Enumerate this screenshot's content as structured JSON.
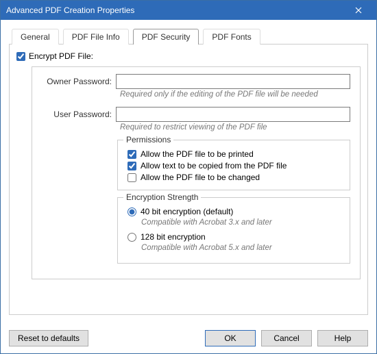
{
  "window": {
    "title": "Advanced PDF Creation Properties"
  },
  "tabs": {
    "general": "General",
    "fileinfo": "PDF File Info",
    "security": "PDF Security",
    "fonts": "PDF Fonts"
  },
  "encrypt": {
    "label": "Encrypt PDF File:"
  },
  "owner": {
    "label": "Owner Password:",
    "value": "",
    "hint": "Required only if the editing of the PDF file will be needed"
  },
  "user": {
    "label": "User Password:",
    "value": "",
    "hint": "Required to restrict viewing of the PDF file"
  },
  "permissions": {
    "legend": "Permissions",
    "print": "Allow the PDF file to be printed",
    "copy": "Allow text to be copied from the PDF file",
    "change": "Allow the PDF file to be changed"
  },
  "encryption": {
    "legend": "Encryption Strength",
    "opt40": "40 bit encryption (default)",
    "hint40": "Compatible with Acrobat 3.x and later",
    "opt128": "128 bit encryption",
    "hint128": "Compatible with Acrobat 5.x and later"
  },
  "buttons": {
    "reset": "Reset to defaults",
    "ok": "OK",
    "cancel": "Cancel",
    "help": "Help"
  }
}
